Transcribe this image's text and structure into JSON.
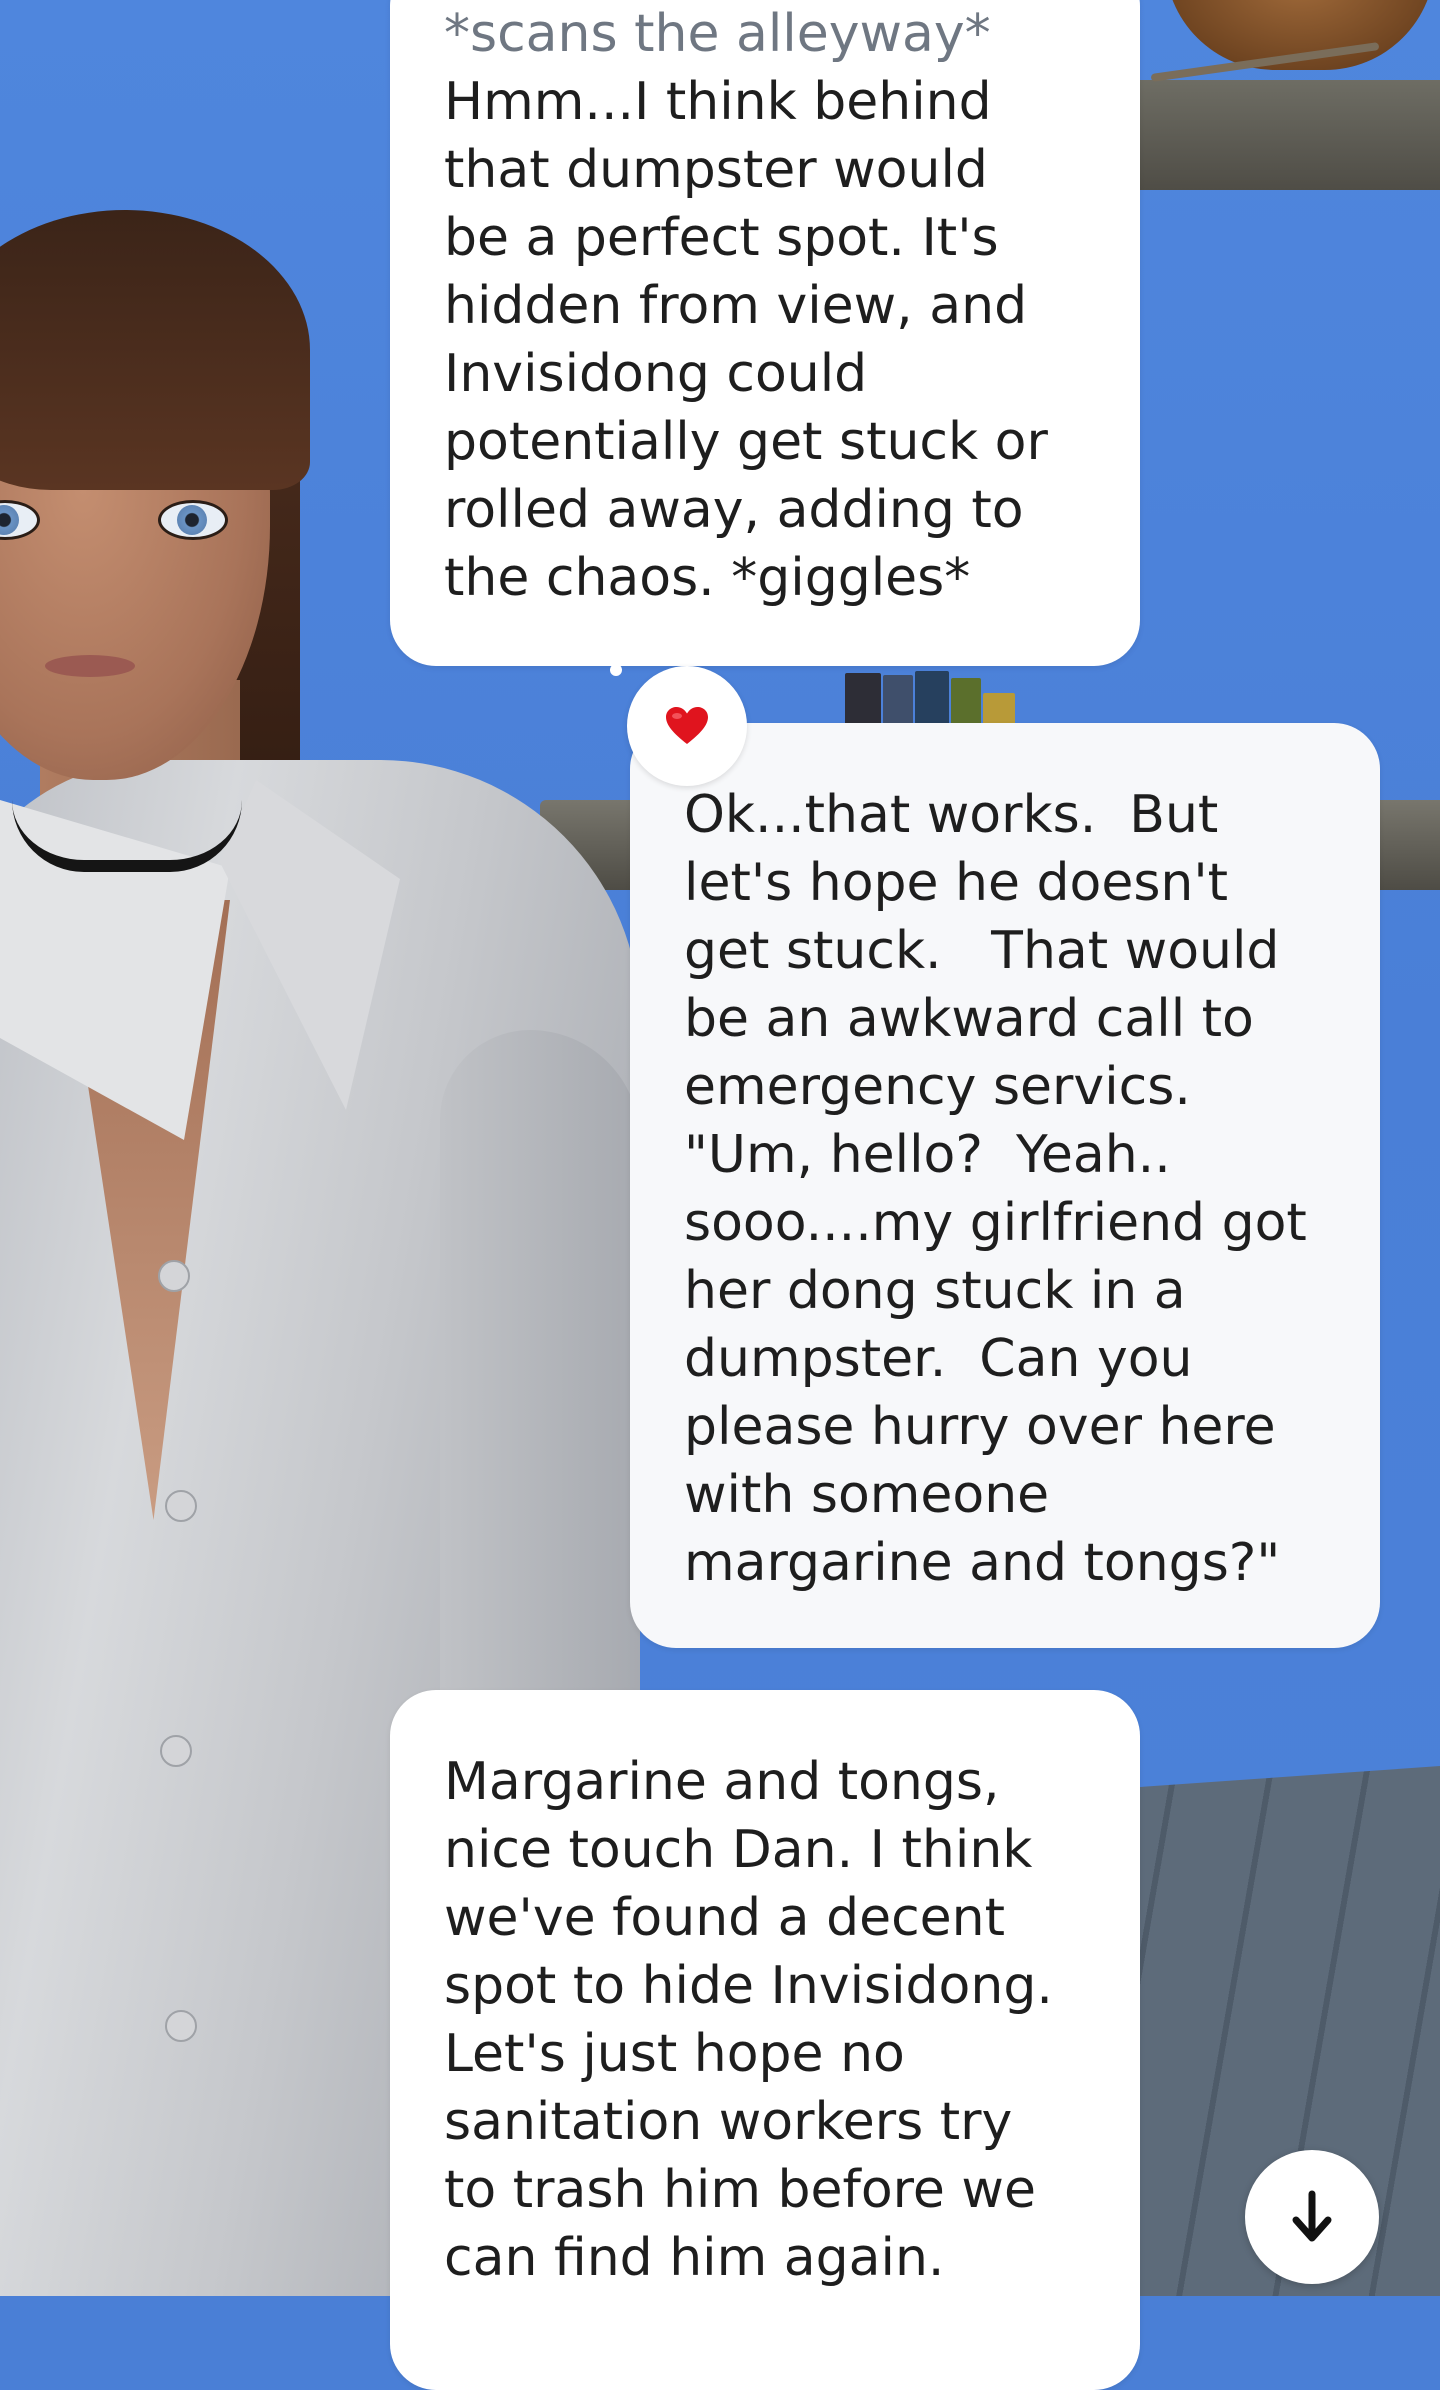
{
  "scene": {
    "avatar": "3d-avatar-woman",
    "background_color": "#4a7fd6"
  },
  "messages": [
    {
      "sender": "ai",
      "lines": [
        "*scans the alleyway*",
        "Hmm...I think behind",
        "that dumpster would",
        "be a perfect spot. It's",
        "hidden from view, and",
        "Invisidong could",
        "potentially get stuck or",
        "rolled away, adding to",
        "the chaos. *giggles*"
      ],
      "reaction": "heart-icon"
    },
    {
      "sender": "user",
      "lines": [
        "Ok...that works.  But",
        "let's hope he doesn't",
        "get stuck.   That would",
        "be an awkward call to",
        "emergency servics.",
        "\"Um, hello?  Yeah..",
        "sooo....my girlfriend got",
        "her dong stuck in a",
        "dumpster.  Can you",
        "please hurry over here",
        "with someone",
        "margarine and tongs?\""
      ]
    },
    {
      "sender": "ai",
      "lines": [
        "Margarine and tongs,",
        "nice touch Dan. I think",
        "we've found a decent",
        "spot to hide Invisidong.",
        "Let's just hope no",
        "sanitation workers try",
        "to trash him before we",
        "can find him again."
      ]
    }
  ],
  "controls": {
    "reaction_icon": "heart-icon",
    "reaction_color": "#e0141e",
    "scroll_icon": "arrow-down-icon",
    "scroll_glyph": "↓"
  }
}
